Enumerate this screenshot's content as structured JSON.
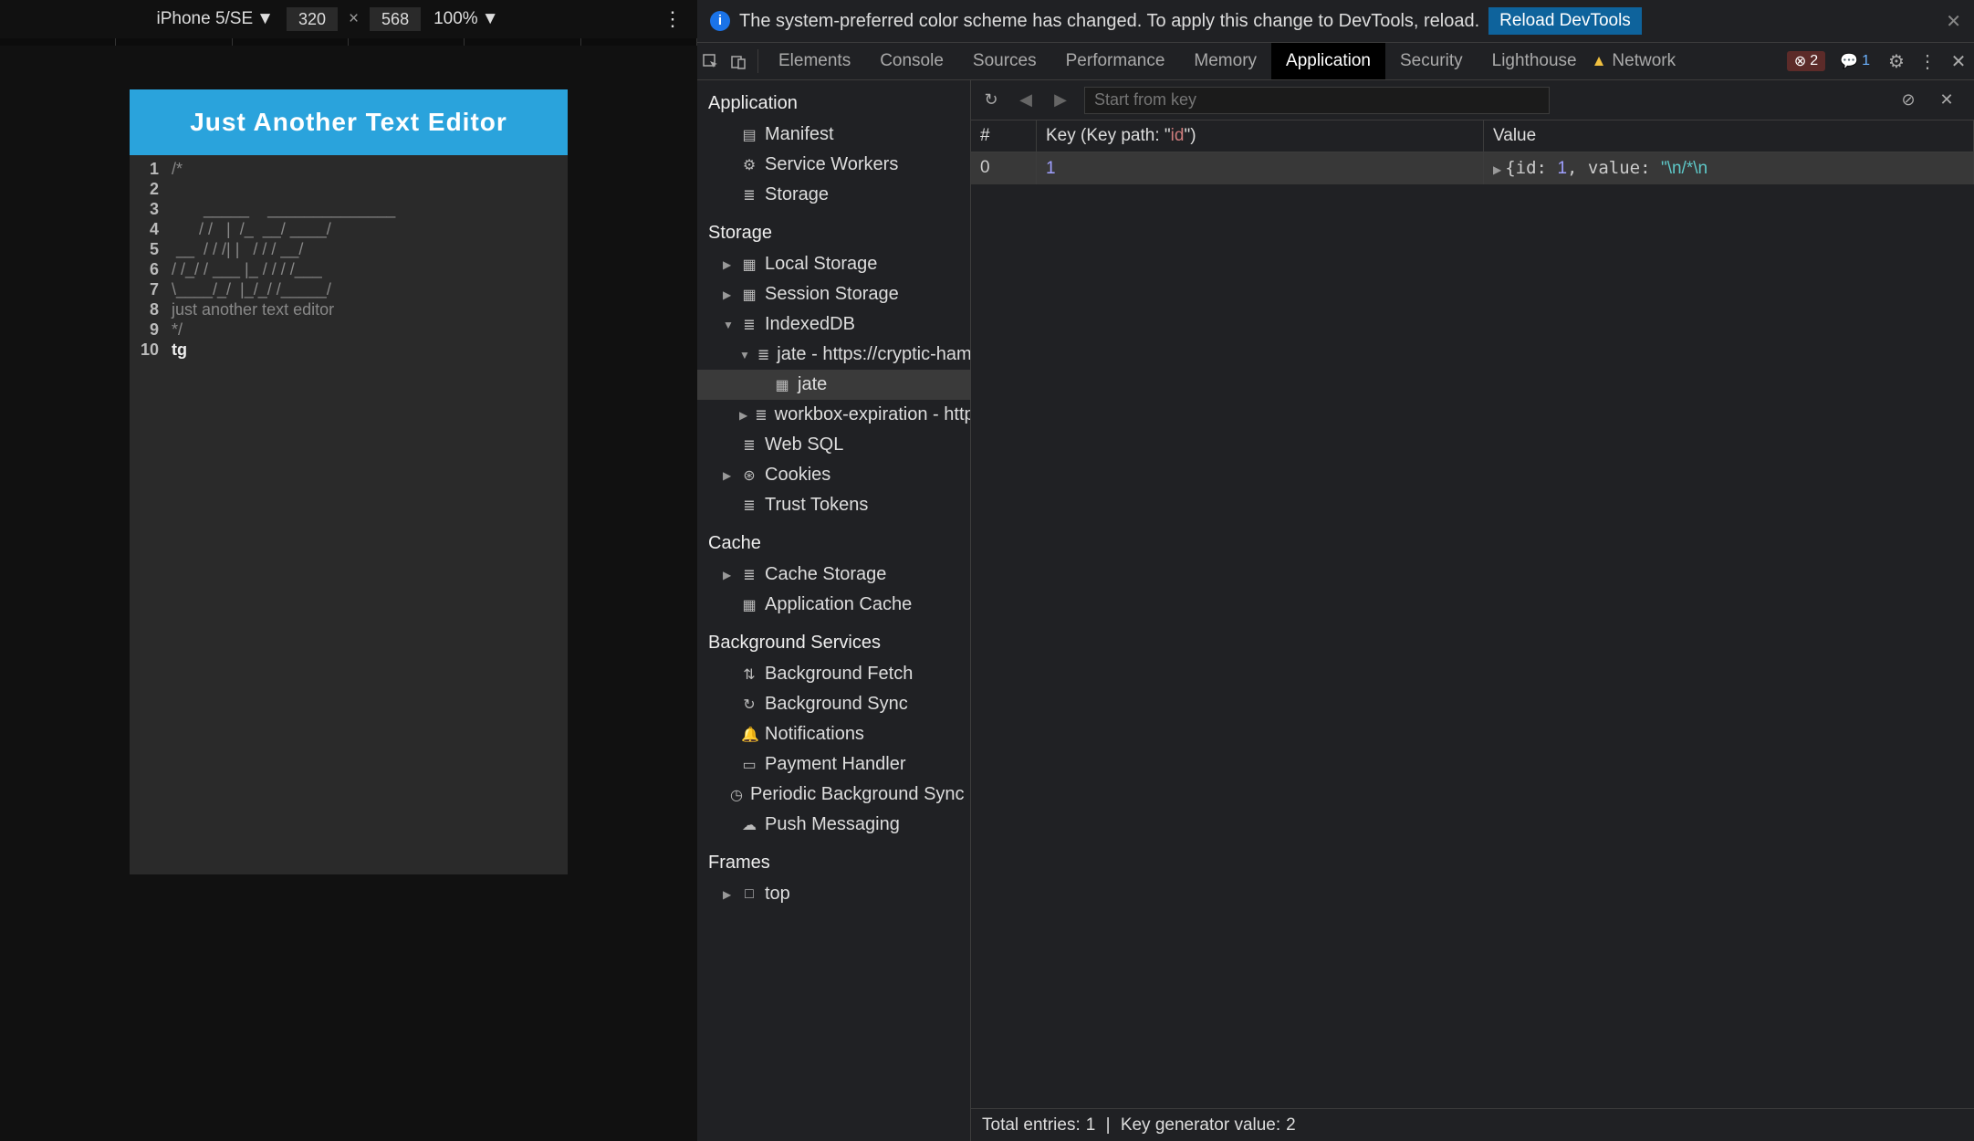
{
  "device_toolbar": {
    "device": "iPhone 5/SE",
    "width": "320",
    "height": "568",
    "zoom": "100%"
  },
  "preview": {
    "title": "Just Another Text Editor",
    "lines": [
      "",
      "/*",
      "",
      "       _____    ______________",
      "      / /   |  /_  __/ ____/",
      " __  / / /| |   / / / __/",
      "/ /_/ / ___ |_ / / / /___",
      "\\____/_/  |_/_/ /_____/",
      "just another text editor",
      "*/",
      "tg"
    ]
  },
  "infobar": {
    "message": "The system-preferred color scheme has changed. To apply this change to DevTools, reload.",
    "button": "Reload DevTools"
  },
  "tabs": {
    "items": [
      "Elements",
      "Console",
      "Sources",
      "Performance",
      "Memory",
      "Application",
      "Security",
      "Lighthouse"
    ],
    "active": "Application",
    "network_label": "Network",
    "error_count": "2",
    "msg_count": "1"
  },
  "sidebar": {
    "groups": [
      {
        "title": "Application",
        "items": [
          {
            "label": "Manifest",
            "icon": "file",
            "depth": 1
          },
          {
            "label": "Service Workers",
            "icon": "gear",
            "depth": 1
          },
          {
            "label": "Storage",
            "icon": "db",
            "depth": 1
          }
        ]
      },
      {
        "title": "Storage",
        "items": [
          {
            "label": "Local Storage",
            "icon": "grid",
            "depth": 1,
            "arrow": "▶"
          },
          {
            "label": "Session Storage",
            "icon": "grid",
            "depth": 1,
            "arrow": "▶"
          },
          {
            "label": "IndexedDB",
            "icon": "db",
            "depth": 1,
            "arrow": "▼"
          },
          {
            "label": "jate - https://cryptic-hamlet",
            "icon": "db",
            "depth": 2,
            "arrow": "▼"
          },
          {
            "label": "jate",
            "icon": "grid",
            "depth": 3,
            "selected": true
          },
          {
            "label": "workbox-expiration - https:",
            "icon": "db",
            "depth": 2,
            "arrow": "▶"
          },
          {
            "label": "Web SQL",
            "icon": "db",
            "depth": 1
          },
          {
            "label": "Cookies",
            "icon": "cookie",
            "depth": 1,
            "arrow": "▶"
          },
          {
            "label": "Trust Tokens",
            "icon": "db",
            "depth": 1
          }
        ]
      },
      {
        "title": "Cache",
        "items": [
          {
            "label": "Cache Storage",
            "icon": "db",
            "depth": 1,
            "arrow": "▶"
          },
          {
            "label": "Application Cache",
            "icon": "grid",
            "depth": 1
          }
        ]
      },
      {
        "title": "Background Services",
        "items": [
          {
            "label": "Background Fetch",
            "icon": "updown",
            "depth": 1
          },
          {
            "label": "Background Sync",
            "icon": "sync",
            "depth": 1
          },
          {
            "label": "Notifications",
            "icon": "bell",
            "depth": 1
          },
          {
            "label": "Payment Handler",
            "icon": "card",
            "depth": 1
          },
          {
            "label": "Periodic Background Sync",
            "icon": "clock",
            "depth": 1
          },
          {
            "label": "Push Messaging",
            "icon": "cloud",
            "depth": 1
          }
        ]
      },
      {
        "title": "Frames",
        "items": [
          {
            "label": "top",
            "icon": "frame",
            "depth": 1,
            "arrow": "▶"
          }
        ]
      }
    ]
  },
  "mainview": {
    "search_placeholder": "Start from key",
    "head_idx": "#",
    "head_key_prefix": "Key (Key path: \"",
    "head_key_path": "id",
    "head_key_suffix": "\")",
    "head_val": "Value",
    "rows": [
      {
        "idx": "0",
        "key": "1",
        "val_prefix": "{id: ",
        "val_id": "1",
        "val_mid": ", value: ",
        "val_str": "\"\\n/*\\n",
        "selected": true
      }
    ],
    "footer_entries_label": "Total entries: ",
    "footer_entries": "1",
    "footer_gen_label": "Key generator value: ",
    "footer_gen": "2"
  }
}
